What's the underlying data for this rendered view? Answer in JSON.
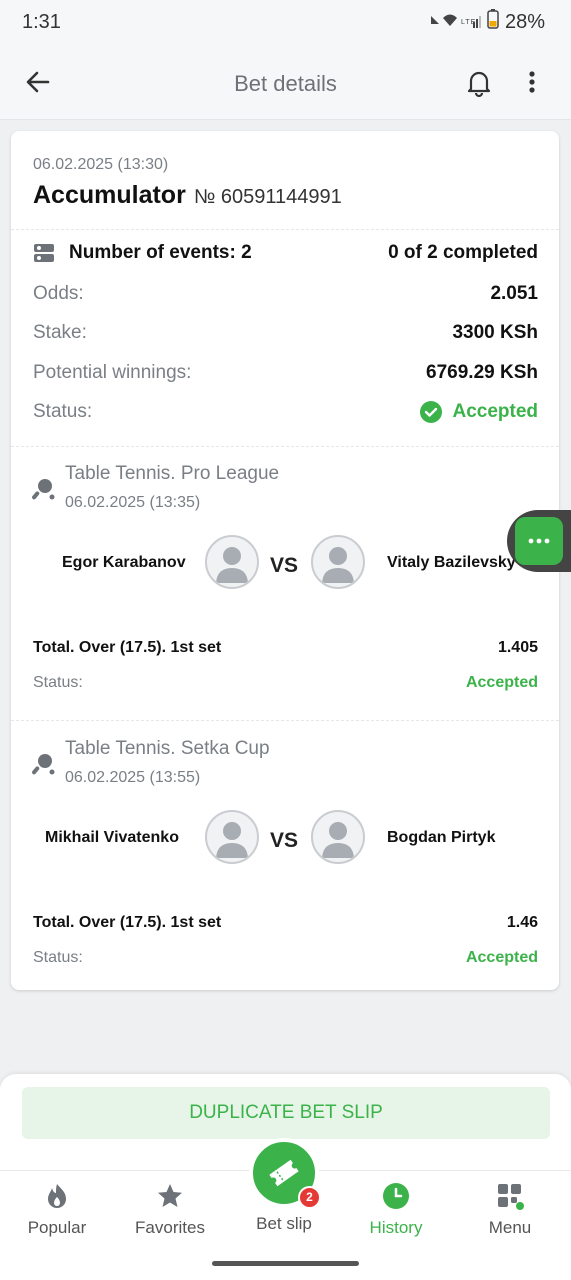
{
  "status_bar": {
    "time": "1:31",
    "battery": "28%",
    "network": "LTE"
  },
  "header": {
    "title": "Bet details"
  },
  "bet": {
    "date": "06.02.2025 (13:30)",
    "type": "Accumulator",
    "number": "№ 60591144991",
    "events_label": "Number of events: 2",
    "completed": "0 of 2 completed",
    "odds_label": "Odds:",
    "odds_value": "2.051",
    "stake_label": "Stake:",
    "stake_value": "3300 KSh",
    "winnings_label": "Potential winnings:",
    "winnings_value": "6769.29 KSh",
    "status_label": "Status:",
    "status_value": "Accepted"
  },
  "events": [
    {
      "league": "Table Tennis. Pro League",
      "date": "06.02.2025 (13:35)",
      "player1": "Egor Karabanov",
      "player2": "Vitaly Bazilevsky",
      "vs": "VS",
      "pick": "Total. Over (17.5). 1st set",
      "odds": "1.405",
      "status_label": "Status:",
      "status": "Accepted"
    },
    {
      "league": "Table Tennis. Setka Cup",
      "date": "06.02.2025 (13:55)",
      "player1": "Mikhail Vivatenko",
      "player2": "Bogdan Pirtyk",
      "vs": "VS",
      "pick": "Total. Over (17.5). 1st set",
      "odds": "1.46",
      "status_label": "Status:",
      "status": "Accepted"
    }
  ],
  "actions": {
    "duplicate": "DUPLICATE BET SLIP"
  },
  "nav": {
    "items": [
      {
        "label": "Popular",
        "icon": "fire-icon"
      },
      {
        "label": "Favorites",
        "icon": "star-icon"
      },
      {
        "label": "Bet slip",
        "icon": "ticket-icon",
        "badge": "2"
      },
      {
        "label": "History",
        "icon": "clock-icon"
      },
      {
        "label": "Menu",
        "icon": "grid-icon"
      }
    ],
    "active": "History"
  },
  "colors": {
    "accent": "#3bb34a",
    "badge": "#e53935",
    "muted": "#7a7f85"
  }
}
